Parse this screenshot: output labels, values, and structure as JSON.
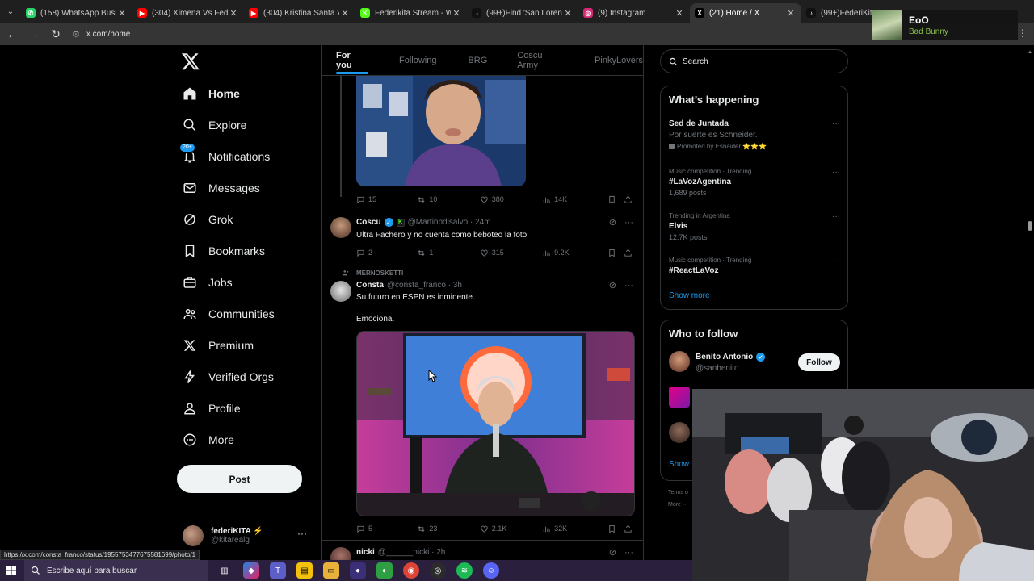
{
  "browser": {
    "tabs": [
      {
        "title": "(158) WhatsApp Business",
        "color": "#25d366",
        "glyph": "✆"
      },
      {
        "title": "(304) Ximena Vs Federikita",
        "color": "#ff0000",
        "glyph": "▶"
      },
      {
        "title": "(304) Kristina Santa VS Tia",
        "color": "#ff0000",
        "glyph": "▶"
      },
      {
        "title": "Federikita Stream - Watch",
        "color": "#53fc18",
        "glyph": "K"
      },
      {
        "title": "(99+)Find 'San Lorenzo' o",
        "color": "#111111",
        "glyph": "♪"
      },
      {
        "title": "(9) Instagram",
        "color": "#d62976",
        "glyph": "◎"
      },
      {
        "title": "(21) Home / X",
        "color": "#000000",
        "glyph": "X"
      },
      {
        "title": "(99+)FederiKita",
        "color": "#111111",
        "glyph": "♪"
      }
    ],
    "url": "x.com/home"
  },
  "music": {
    "title": "EoO",
    "artist": "Bad Bunny"
  },
  "nav": {
    "items": [
      {
        "label": "Home"
      },
      {
        "label": "Explore"
      },
      {
        "label": "Notifications",
        "badge": "20+"
      },
      {
        "label": "Messages"
      },
      {
        "label": "Grok"
      },
      {
        "label": "Bookmarks"
      },
      {
        "label": "Jobs"
      },
      {
        "label": "Communities"
      },
      {
        "label": "Premium"
      },
      {
        "label": "Verified Orgs"
      },
      {
        "label": "Profile"
      },
      {
        "label": "More"
      }
    ],
    "post_label": "Post",
    "account": {
      "name": "federiKITA ⚡",
      "handle": "@kitarealg"
    }
  },
  "feed": {
    "tabs": [
      "For you",
      "Following",
      "BRG",
      "Coscu Army",
      "PinkyLovers"
    ],
    "tweet1_actions": {
      "replies": "15",
      "reposts": "10",
      "likes": "380",
      "views": "14K"
    },
    "tweet2": {
      "name": "Coscu",
      "handle": "@Martinpdisalvo · 24m",
      "text": "Ultra Fachero y no cuenta como beboteo la foto",
      "actions": {
        "replies": "2",
        "reposts": "1",
        "likes": "315",
        "views": "9.2K"
      }
    },
    "tweet3": {
      "social_context": "MERNOSKETTI",
      "name": "Consta",
      "handle": "@consta_franco · 3h",
      "text1": "Su futuro en ESPN es inminente.",
      "text2": "Emociona.",
      "actions": {
        "replies": "5",
        "reposts": "23",
        "likes": "2.1K",
        "views": "32K"
      }
    },
    "tweet4": {
      "name": "nicki",
      "handle": "@______nicki · 2h"
    }
  },
  "sidebar": {
    "search_placeholder": "Search",
    "happening_title": "What’s happening",
    "trends": [
      {
        "context": "",
        "title": "Sed de Juntada",
        "sub": "Por suerte es Schneider.",
        "promo": "Promoted by Esnáider ⭐⭐⭐"
      },
      {
        "context": "Music competition · Trending",
        "title": "#LaVozAgentina",
        "sub": "1,689 posts"
      },
      {
        "context": "Trending in Argentina",
        "title": "Elvis",
        "sub": "12.7K posts"
      },
      {
        "context": "Music competition · Trending",
        "title": "#ReactLaVoz",
        "sub": ""
      }
    ],
    "show_more": "Show more",
    "who_to_follow_title": "Who to follow",
    "follow": {
      "name": "Benito Antonio",
      "handle": "@sanbenito",
      "button": "Follow"
    },
    "show_more_2": "Show",
    "terms": "Terms o",
    "more_link": "More ···"
  },
  "status_url": "https://x.com/consta_franco/status/1955753477675581699/photo/1",
  "taskbar": {
    "search_placeholder": "Escribe aquí para buscar"
  }
}
